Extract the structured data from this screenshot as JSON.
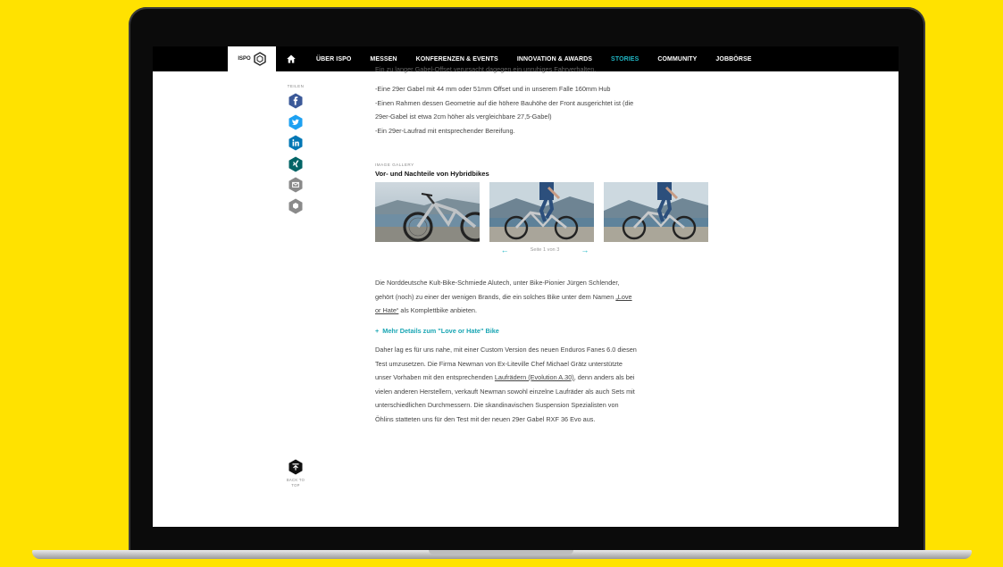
{
  "nav": {
    "logo_text": "ISPO",
    "items": [
      {
        "label": "ÜBER ISPO"
      },
      {
        "label": "MESSEN"
      },
      {
        "label": "KONFERENZEN & EVENTS"
      },
      {
        "label": "INNOVATION & AWARDS"
      },
      {
        "label": "STORIES",
        "active": true
      },
      {
        "label": "COMMUNITY"
      },
      {
        "label": "JOBBÖRSE"
      }
    ],
    "active_color": "#20b6c4"
  },
  "share": {
    "label": "TEILEN",
    "buttons": [
      {
        "icon": "facebook-icon",
        "color": "#3b5998"
      },
      {
        "icon": "twitter-icon",
        "color": "#1da1f2"
      },
      {
        "icon": "linkedin-icon",
        "color": "#0077b5"
      },
      {
        "icon": "xing-icon",
        "color": "#026466"
      },
      {
        "icon": "email-icon",
        "color": "#8a8a8a"
      },
      {
        "icon": "share-more-icon",
        "color": "#8a8a8a"
      }
    ]
  },
  "article": {
    "cut_line": "Ein zu langer Gabel-Offset verursacht dagegen ein unruhiges Fahrverhalten.",
    "list_lines": [
      "-Eine 29er Gabel mit 44 mm oder 51mm Offset und in unserem Falle 160mm Hub",
      "-Einen Rahmen dessen Geometrie auf die höhere Bauhöhe der Front ausgerichtet ist (die",
      "29er-Gabel ist etwa 2cm höher als vergleichbare 27,5-Gabel)",
      "-Ein 29er-Laufrad mit entsprechender Bereifung."
    ],
    "gallery": {
      "label": "IMAGE GALLERY",
      "title": "Vor- und Nachteile von Hybridbikes",
      "pager_text": "Seite 1 von 3",
      "prev_icon": "arrow-left-icon",
      "next_icon": "arrow-right-icon"
    },
    "para1": {
      "line1": "Die Norddeutsche Kult-Bike-Schmiede Alutech, unter Bike-Pionier Jürgen Schlender,",
      "line2_pre": "gehört (noch) zu einer der wenigen Brands, die ein solches Bike unter dem Namen ",
      "line2_link": "„Love",
      "line3_link": "or Hate“",
      "line3_post": " als Komplettbike anbieten."
    },
    "mehr_link": "Mehr Details zum \"Love or Hate\" Bike",
    "para2": {
      "l1": "Daher lag es für uns nahe, mit einer Custom Version des neuen Enduros Fanes 6.0 diesen",
      "l2": "Test umzusetzen. Die Firma Newman von Ex-Liteville Chef Michael Grätz unterstützte",
      "l3_pre": "unser Vorhaben mit den entsprechenden ",
      "l3_link": "Laufrädern (Evolution A.30)",
      "l3_post": ", denn anders als bei",
      "l4": "vielen anderen Herstellern, verkauft Newman sowohl einzelne Laufräder als auch Sets mit",
      "l5": "unterschiedlichen Durchmessern. Die skandinavischen Suspension Spezialisten von",
      "l6": "Öhlins statteten uns für den Test mit der neuen 29er Gabel RXF 36 Evo aus."
    }
  },
  "back_to_top": {
    "line1": "BACK TO",
    "line2": "TOP"
  }
}
